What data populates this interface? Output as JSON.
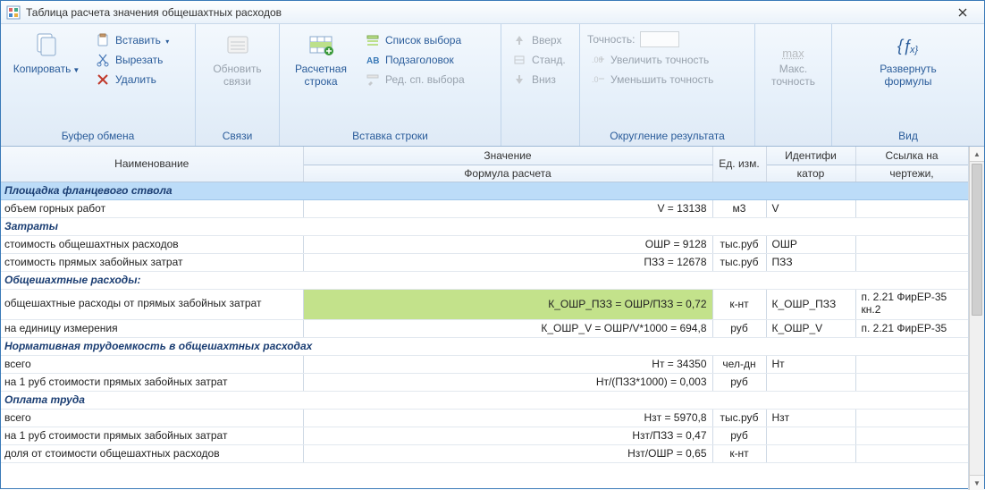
{
  "window": {
    "title": "Таблица расчета значения общешахтных расходов"
  },
  "ribbon": {
    "clipboard": {
      "label": "Буфер обмена",
      "copy": "Копировать",
      "paste": "Вставить",
      "cut": "Вырезать",
      "delete": "Удалить"
    },
    "links": {
      "label": "Связи",
      "refresh": "Обновить связи"
    },
    "insert": {
      "label": "Вставка строки",
      "calc_row": "Расчетная строка",
      "select_list": "Список выбора",
      "subheader": "Подзаголовок",
      "edit_select": "Ред. сп. выбора"
    },
    "move": {
      "up": "Вверх",
      "std": "Станд.",
      "down": "Вниз"
    },
    "round": {
      "label": "Округление результата",
      "precision": "Точность:",
      "inc": "Увеличить точность",
      "dec": "Уменьшить точность"
    },
    "maxp": {
      "top": "max",
      "label": "Макс. точность"
    },
    "view": {
      "label": "Вид",
      "expand": "Развернуть формулы"
    }
  },
  "columns": {
    "name": "Наименование",
    "value_top": "Значение",
    "value_bot": "Формула расчета",
    "unit": "Ед. изм.",
    "id_top": "Идентифи",
    "id_bot": "катор",
    "ref_top": "Ссылка на",
    "ref_bot": "чертежи,"
  },
  "rows": [
    {
      "type": "section-blue",
      "name": "Площадка фланцевого ствола"
    },
    {
      "type": "data",
      "name": "объем горных работ",
      "value": "V = 13138",
      "unit": "м3",
      "id": "V"
    },
    {
      "type": "section-white",
      "name": "Затраты"
    },
    {
      "type": "data",
      "name": "стоимость общешахтных расходов",
      "value": "ОШР = 9128",
      "unit": "тыс.руб",
      "id": "ОШР"
    },
    {
      "type": "data",
      "name": "стоимость прямых забойных затрат",
      "value": "ПЗЗ = 12678",
      "unit": "тыс.руб",
      "id": "ПЗЗ"
    },
    {
      "type": "section-white",
      "name": "Общешахтные расходы:"
    },
    {
      "type": "data",
      "name": "общешахтные расходы от прямых забойных затрат",
      "value": "К_ОШР_ПЗЗ = ОШР/ПЗЗ = 0,72",
      "unit": "к-нт",
      "id": "К_ОШР_ПЗЗ",
      "ref": "п. 2.21 ФирЕР-35 кн.2",
      "wrapName": true,
      "hl": true
    },
    {
      "type": "data",
      "name": "на единицу измерения",
      "value": "К_ОШР_V = ОШР/V*1000 = 694,8",
      "unit": "руб",
      "id": "К_ОШР_V",
      "ref": "п. 2.21 ФирЕР-35"
    },
    {
      "type": "section-white",
      "name": "Нормативная трудоемкость в общешахтных расходах"
    },
    {
      "type": "data",
      "name": "всего",
      "value": "Нт = 34350",
      "unit": "чел-дн",
      "id": "Нт"
    },
    {
      "type": "data",
      "name": "на 1 руб стоимости прямых забойных затрат",
      "value": "Нт/(ПЗЗ*1000) = 0,003",
      "unit": "руб"
    },
    {
      "type": "section-white",
      "name": "Оплата труда"
    },
    {
      "type": "data",
      "name": "всего",
      "value": "Нзт = 5970,8",
      "unit": "тыс.руб",
      "id": "Нзт"
    },
    {
      "type": "data",
      "name": "на 1 руб стоимости прямых забойных затрат",
      "value": "Нзт/ПЗЗ = 0,47",
      "unit": "руб"
    },
    {
      "type": "data",
      "name": "доля от стоимости общешахтных расходов",
      "value": "Нзт/ОШР = 0,65",
      "unit": "к-нт"
    }
  ]
}
